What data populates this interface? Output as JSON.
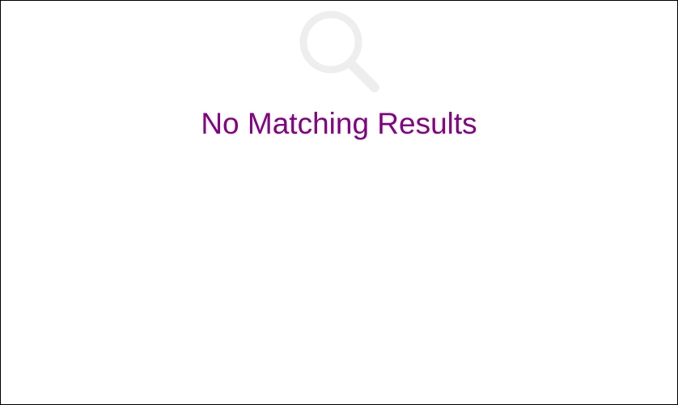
{
  "empty_state": {
    "icon": "search-icon",
    "icon_color": "#eeeeee",
    "message": "No Matching Results",
    "message_color": "#800080"
  }
}
